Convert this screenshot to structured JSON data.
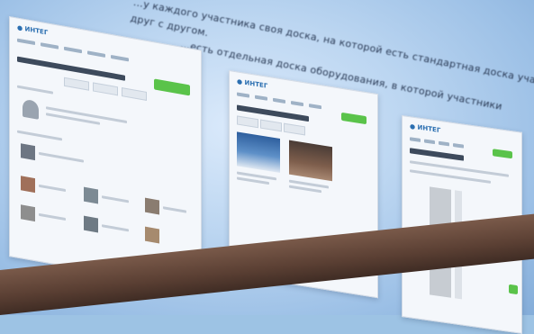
{
  "slide": {
    "heading_lines": [
      "...у каждого участника своя доска, на которой есть стандартная доска участия пользователей",
      "друг с другом.",
      "...есть отдельная доска оборудования, в которой участники"
    ]
  },
  "colors": {
    "accent_green": "#5ac34a",
    "brand_blue": "#2b6fb1",
    "slide_background": "#bcd6f1"
  },
  "cards": {
    "profile": {
      "logo": "● ИНТЕГ"
    },
    "equipment": {
      "logo": "● ИНТЕГ"
    },
    "schedule": {
      "logo": "● ИНТЕГ"
    }
  }
}
